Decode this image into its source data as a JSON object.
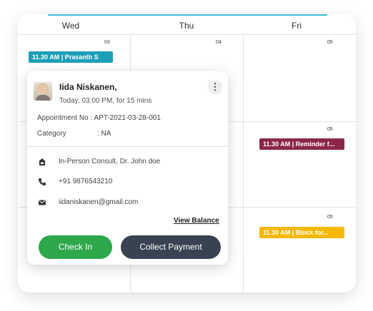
{
  "calendar": {
    "days": [
      "Wed",
      "Thu",
      "Fri"
    ],
    "dates": {
      "row1": [
        "03",
        "04",
        "05"
      ],
      "row2_fri": "05",
      "row3_fri": "05"
    },
    "events": [
      {
        "label": "11.30 AM | Prasanth S",
        "color": "#1d9fb8"
      },
      {
        "label": "11.30 AM | Reminder f...",
        "color": "#8c2749"
      },
      {
        "label": "11.30 AM | Block for...",
        "color": "#f5b800"
      }
    ]
  },
  "popup": {
    "name": "Iida Niskanen,",
    "time": "Today, 03:00 PM, for 15 mins",
    "appointment_no": "Appointment No : APT-2021-03-28-001",
    "category_label": "Category",
    "category_value": ": NA",
    "consult": "In-Person Consult, Dr. John doe",
    "phone": "+91 9876543210",
    "email": "iidaniskanen@gmail.com",
    "view_balance": "View Balance",
    "check_in": "Check In",
    "collect_payment": "Collect Payment",
    "kebab": "⋮"
  },
  "colors": {
    "accent_line": "#39c0d8",
    "check_in": "#2da84a",
    "collect_payment": "#384250"
  }
}
